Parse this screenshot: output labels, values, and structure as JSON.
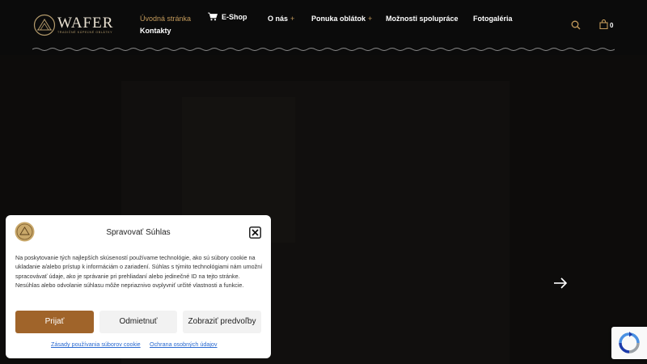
{
  "header": {
    "logo_text": "WAFER",
    "logo_tagline": "TRADIČNÉ KÚPEĽNÉ OBLÁTKY",
    "nav": [
      {
        "label": "Úvodná stránka"
      },
      {
        "label": "E-Shop"
      },
      {
        "label": "O nás",
        "plus": "+"
      },
      {
        "label": "Ponuka oblátok",
        "plus": "+"
      },
      {
        "label": "Možnosti spolupráce"
      },
      {
        "label": "Fotogaléria"
      },
      {
        "label": "Kontakty"
      }
    ],
    "cart_count": "0",
    "accent_color": "#c39a5b",
    "icons": [
      "search-icon",
      "shopping-bag-icon",
      "cart-icon"
    ]
  },
  "hero": {
    "next_icon": "arrow-right-icon"
  },
  "consent": {
    "title": "Spravovať Súhlas",
    "text": "Na poskytovanie tých najlepších skúseností používame technológie, ako sú súbory cookie na ukladanie a/alebo prístup k informáciám o zariadení. Súhlas s týmito technológiami nám umožní spracovávať údaje, ako je správanie pri prehliadaní alebo jedinečné ID na tejto stránke. Nesúhlas alebo odvolanie súhlasu môže nepriaznivo ovplyvniť určité vlastnosti a funkcie.",
    "accept_label": "Prijať",
    "deny_label": "Odmietnuť",
    "prefs_label": "Zobraziť predvoľby",
    "cookie_policy_link": "Zásady používania súborov cookie",
    "privacy_link": "Ochrana osobných údajov",
    "accept_color": "#a0642a"
  }
}
